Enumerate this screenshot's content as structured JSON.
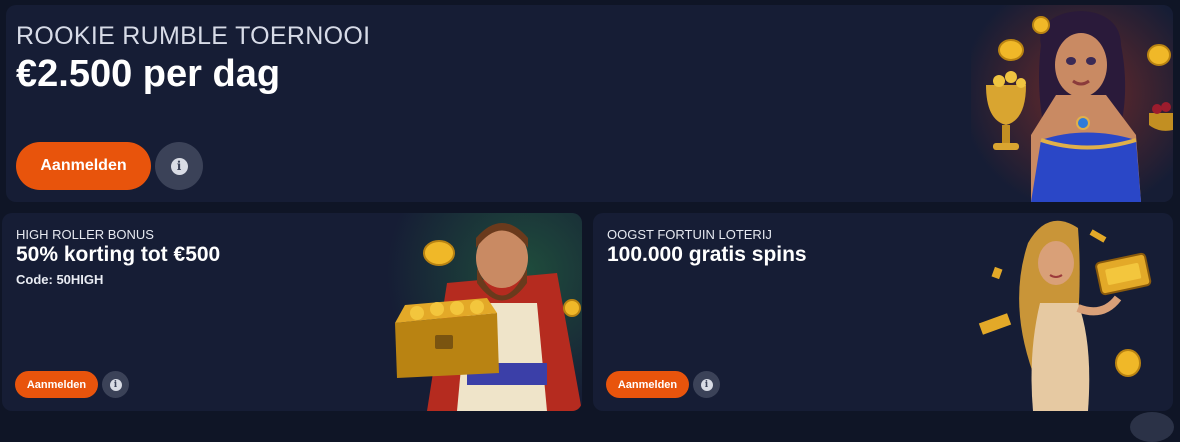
{
  "hero": {
    "subtitle": "ROOKIE RUMBLE TOERNOOI",
    "title": "€2.500 per dag",
    "button_label": "Aanmelden",
    "info_icon": "i"
  },
  "promos": [
    {
      "subtitle": "HIGH ROLLER BONUS",
      "title": "50% korting tot €500",
      "code": "Code: 50HIGH",
      "button_label": "Aanmelden",
      "info_icon": "i"
    },
    {
      "subtitle": "OOGST FORTUIN LOTERIJ",
      "title": "100.000 gratis spins",
      "button_label": "Aanmelden",
      "info_icon": "i"
    }
  ],
  "colors": {
    "page_bg": "#0f1526",
    "card_bg": "#161d35",
    "accent": "#e8540c",
    "info_btn": "#3b4258"
  },
  "illustrations": [
    "sorceress-with-gold-chalice",
    "king-with-treasure-chest",
    "golden-lady-with-ticket"
  ]
}
